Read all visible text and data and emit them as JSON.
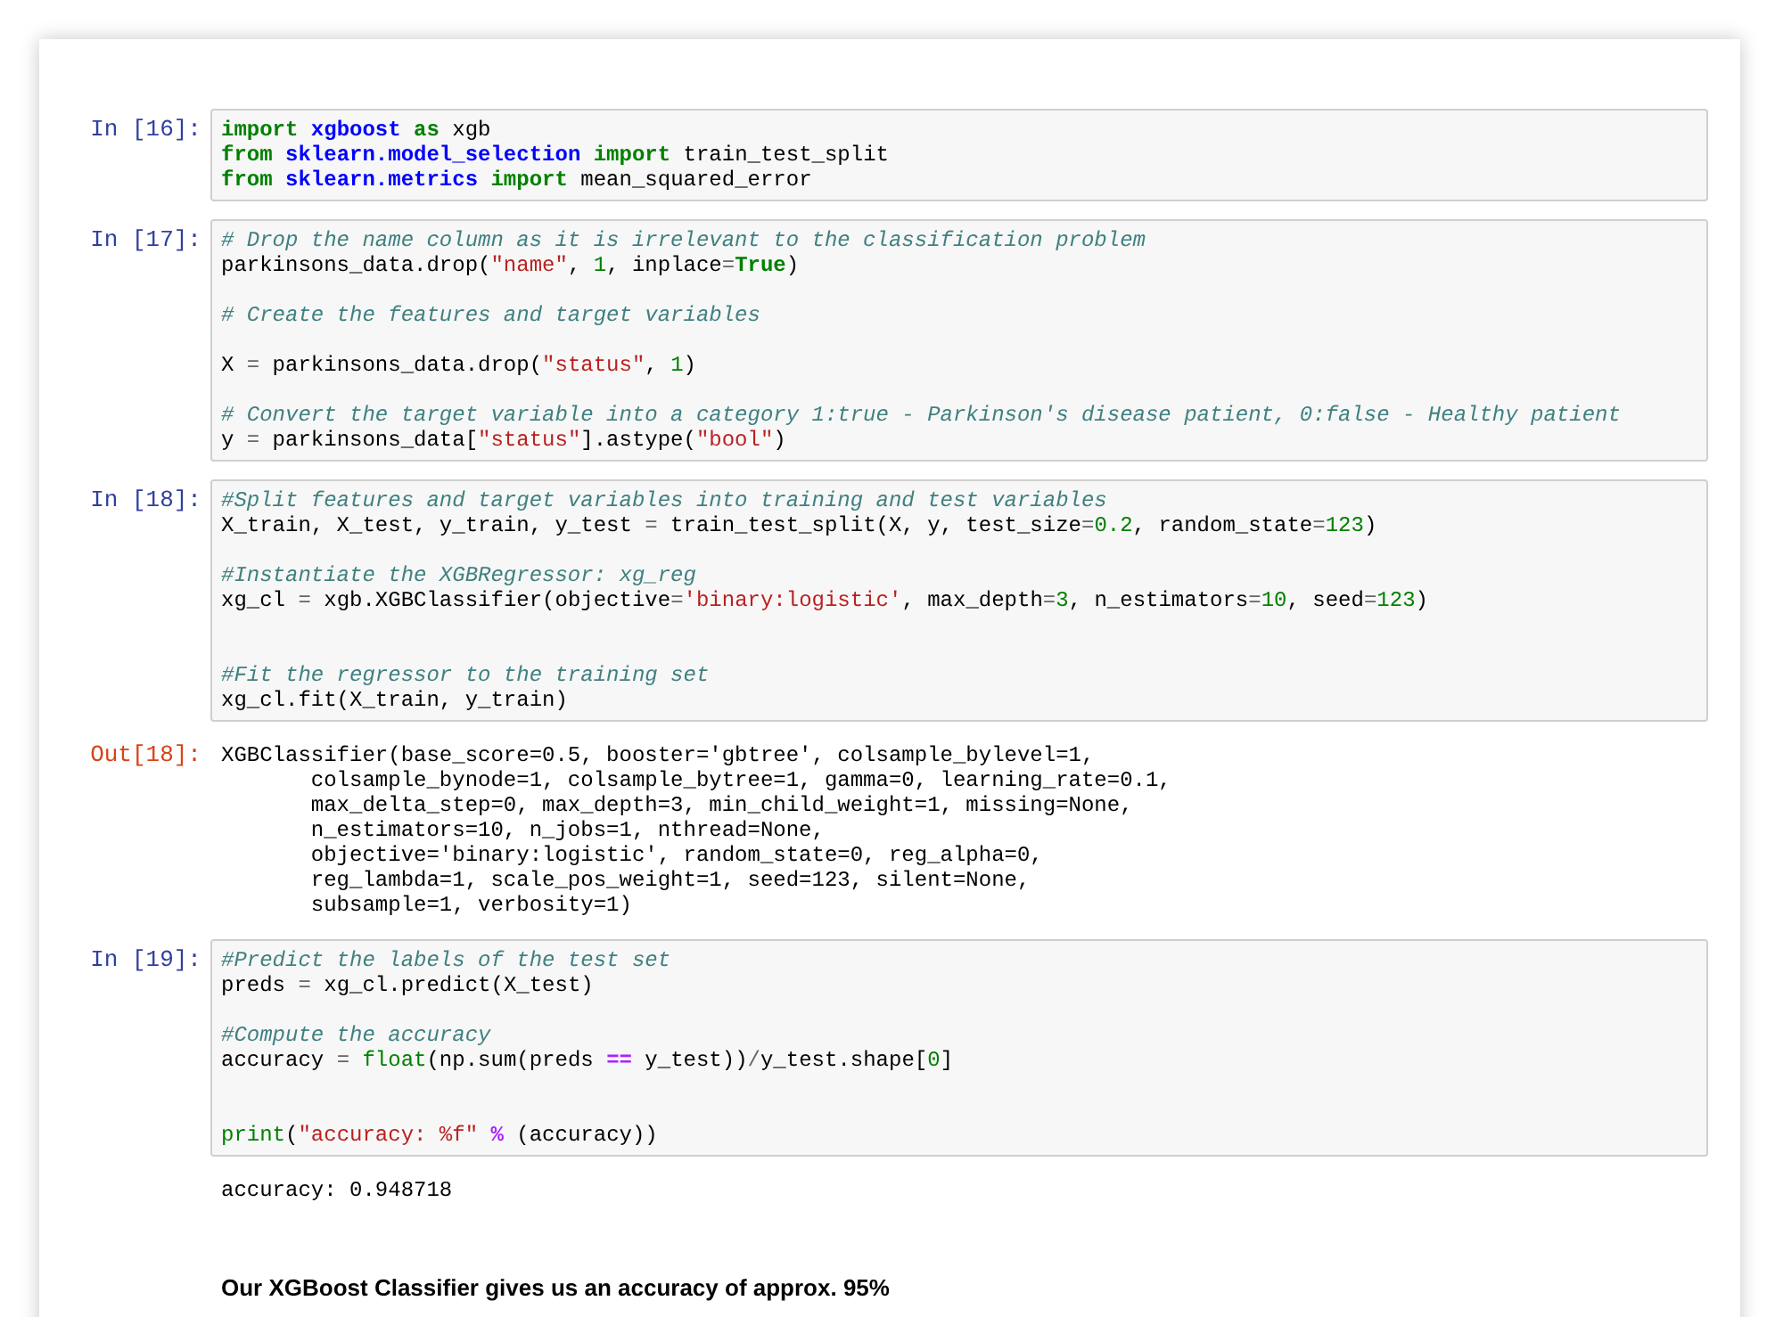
{
  "cells": [
    {
      "kind": "code",
      "prompt": "In [16]:",
      "lines": [
        {
          "kind": "code",
          "tokens": [
            {
              "text": "import ",
              "kind": "kw"
            },
            {
              "text": "xgboost ",
              "kind": "ns"
            },
            {
              "text": "as",
              "kind": "kw"
            },
            {
              "text": " xgb",
              "kind": "plain"
            }
          ]
        },
        {
          "kind": "code",
          "tokens": [
            {
              "text": "from ",
              "kind": "kw"
            },
            {
              "text": "sklearn.model_selection ",
              "kind": "ns"
            },
            {
              "text": "import",
              "kind": "kw"
            },
            {
              "text": " train_test_split",
              "kind": "plain"
            }
          ]
        },
        {
          "kind": "code",
          "tokens": [
            {
              "text": "from ",
              "kind": "kw"
            },
            {
              "text": "sklearn.metrics ",
              "kind": "ns"
            },
            {
              "text": "import",
              "kind": "kw"
            },
            {
              "text": " mean_squared_error",
              "kind": "plain"
            }
          ]
        }
      ]
    },
    {
      "kind": "code",
      "prompt": "In [17]:",
      "lines": [
        {
          "kind": "code",
          "tokens": [
            {
              "text": "# Drop the name column as it is irrelevant to the classification problem",
              "kind": "cm"
            }
          ]
        },
        {
          "kind": "code",
          "tokens": [
            {
              "text": "parkinsons_data.drop(",
              "kind": "plain"
            },
            {
              "text": "\"name\"",
              "kind": "str"
            },
            {
              "text": ", ",
              "kind": "plain"
            },
            {
              "text": "1",
              "kind": "num"
            },
            {
              "text": ", inplace",
              "kind": "plain"
            },
            {
              "text": "=",
              "kind": "op"
            },
            {
              "text": "True",
              "kind": "kw"
            },
            {
              "text": ")",
              "kind": "plain"
            }
          ]
        },
        {
          "kind": "blank"
        },
        {
          "kind": "code",
          "tokens": [
            {
              "text": "# Create the features and target variables",
              "kind": "cm"
            }
          ]
        },
        {
          "kind": "blank"
        },
        {
          "kind": "code",
          "tokens": [
            {
              "text": "X ",
              "kind": "plain"
            },
            {
              "text": "=",
              "kind": "op"
            },
            {
              "text": " parkinsons_data.drop(",
              "kind": "plain"
            },
            {
              "text": "\"status\"",
              "kind": "str"
            },
            {
              "text": ", ",
              "kind": "plain"
            },
            {
              "text": "1",
              "kind": "num"
            },
            {
              "text": ")",
              "kind": "plain"
            }
          ]
        },
        {
          "kind": "blank"
        },
        {
          "kind": "code",
          "tokens": [
            {
              "text": "# Convert the target variable into a category 1:true - Parkinson's disease patient, 0:false - Healthy patient",
              "kind": "cm"
            }
          ]
        },
        {
          "kind": "code",
          "tokens": [
            {
              "text": "y ",
              "kind": "plain"
            },
            {
              "text": "=",
              "kind": "op"
            },
            {
              "text": " parkinsons_data[",
              "kind": "plain"
            },
            {
              "text": "\"status\"",
              "kind": "str"
            },
            {
              "text": "].astype(",
              "kind": "plain"
            },
            {
              "text": "\"bool\"",
              "kind": "str"
            },
            {
              "text": ")",
              "kind": "plain"
            }
          ]
        }
      ]
    },
    {
      "kind": "code",
      "prompt": "In [18]:",
      "lines": [
        {
          "kind": "code",
          "tokens": [
            {
              "text": "#Split features and target variables into training and test variables",
              "kind": "cm"
            }
          ]
        },
        {
          "kind": "code",
          "tokens": [
            {
              "text": "X_train, X_test, y_train, y_test ",
              "kind": "plain"
            },
            {
              "text": "=",
              "kind": "op"
            },
            {
              "text": " train_test_split(X, y, test_size",
              "kind": "plain"
            },
            {
              "text": "=",
              "kind": "op"
            },
            {
              "text": "0.2",
              "kind": "num"
            },
            {
              "text": ", random_state",
              "kind": "plain"
            },
            {
              "text": "=",
              "kind": "op"
            },
            {
              "text": "123",
              "kind": "num"
            },
            {
              "text": ")",
              "kind": "plain"
            }
          ]
        },
        {
          "kind": "blank"
        },
        {
          "kind": "code",
          "tokens": [
            {
              "text": "#Instantiate the XGBRegressor: xg_reg",
              "kind": "cm"
            }
          ]
        },
        {
          "kind": "code",
          "tokens": [
            {
              "text": "xg_cl ",
              "kind": "plain"
            },
            {
              "text": "=",
              "kind": "op"
            },
            {
              "text": " xgb.XGBClassifier(objective",
              "kind": "plain"
            },
            {
              "text": "=",
              "kind": "op"
            },
            {
              "text": "'binary:logistic'",
              "kind": "str"
            },
            {
              "text": ", max_depth",
              "kind": "plain"
            },
            {
              "text": "=",
              "kind": "op"
            },
            {
              "text": "3",
              "kind": "num"
            },
            {
              "text": ", n_estimators",
              "kind": "plain"
            },
            {
              "text": "=",
              "kind": "op"
            },
            {
              "text": "10",
              "kind": "num"
            },
            {
              "text": ", seed",
              "kind": "plain"
            },
            {
              "text": "=",
              "kind": "op"
            },
            {
              "text": "123",
              "kind": "num"
            },
            {
              "text": ")",
              "kind": "plain"
            }
          ]
        },
        {
          "kind": "blank"
        },
        {
          "kind": "blank"
        },
        {
          "kind": "code",
          "tokens": [
            {
              "text": "#Fit the regressor to the training set",
              "kind": "cm"
            }
          ]
        },
        {
          "kind": "code",
          "tokens": [
            {
              "text": "xg_cl.fit(X_train, y_train)",
              "kind": "plain"
            }
          ]
        }
      ]
    },
    {
      "kind": "output",
      "prompt": "Out[18]:",
      "text": "XGBClassifier(base_score=0.5, booster='gbtree', colsample_bylevel=1,\n       colsample_bynode=1, colsample_bytree=1, gamma=0, learning_rate=0.1,\n       max_delta_step=0, max_depth=3, min_child_weight=1, missing=None,\n       n_estimators=10, n_jobs=1, nthread=None,\n       objective='binary:logistic', random_state=0, reg_alpha=0,\n       reg_lambda=1, scale_pos_weight=1, seed=123, silent=None,\n       subsample=1, verbosity=1)"
    },
    {
      "kind": "code",
      "prompt": "In [19]:",
      "lines": [
        {
          "kind": "code",
          "tokens": [
            {
              "text": "#Predict the labels of the test set",
              "kind": "cm"
            }
          ]
        },
        {
          "kind": "code",
          "tokens": [
            {
              "text": "preds ",
              "kind": "plain"
            },
            {
              "text": "=",
              "kind": "op"
            },
            {
              "text": " xg_cl.predict(X_test)",
              "kind": "plain"
            }
          ]
        },
        {
          "kind": "blank"
        },
        {
          "kind": "code",
          "tokens": [
            {
              "text": "#Compute the accuracy",
              "kind": "cm"
            }
          ]
        },
        {
          "kind": "code",
          "tokens": [
            {
              "text": "accuracy ",
              "kind": "plain"
            },
            {
              "text": "= ",
              "kind": "op"
            },
            {
              "text": "float",
              "kind": "bi"
            },
            {
              "text": "(np.sum(preds ",
              "kind": "plain"
            },
            {
              "text": "==",
              "kind": "opw"
            },
            {
              "text": " y_test))",
              "kind": "plain"
            },
            {
              "text": "/",
              "kind": "op"
            },
            {
              "text": "y_test.shape[",
              "kind": "plain"
            },
            {
              "text": "0",
              "kind": "num"
            },
            {
              "text": "]",
              "kind": "plain"
            }
          ]
        },
        {
          "kind": "blank"
        },
        {
          "kind": "blank"
        },
        {
          "kind": "code",
          "tokens": [
            {
              "text": "print",
              "kind": "bi"
            },
            {
              "text": "(",
              "kind": "plain"
            },
            {
              "text": "\"accuracy: %f\" ",
              "kind": "str"
            },
            {
              "text": "%",
              "kind": "opw"
            },
            {
              "text": " (accuracy))",
              "kind": "plain"
            }
          ]
        }
      ]
    },
    {
      "kind": "stream",
      "text": "accuracy: 0.948718"
    },
    {
      "kind": "markdown",
      "text": "Our XGBoost Classifier gives us an accuracy of approx. 95%"
    }
  ]
}
